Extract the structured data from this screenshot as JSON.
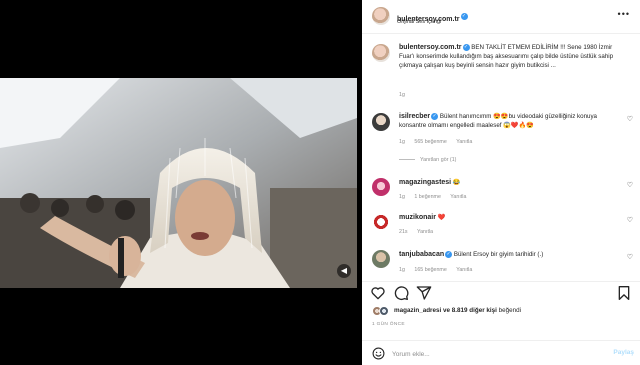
{
  "post": {
    "author": "bulentersoy.com.tr",
    "audio": "Orijinal Ses İçeriği"
  },
  "caption": {
    "username": "bulentersoy.com.tr",
    "text": "BEN TAKLİT ETMEM EDİLİRİM !!! Sene 1980 İzmir Fuar'ı konserimde kullandığım baş aksesuarımı çalıp bilde üstüne üstlük sahip çıkmaya çalışan kuş beyinli sensin hazır giyim butikcisi ...",
    "age": "1g"
  },
  "comments": [
    {
      "username": "isilrecber",
      "verified": true,
      "text": "Bülent hanımcımm 😍😍bu videodaki güzelliğiniz konuya konsantre olmamı engelledi maalesef 😱❤️🔥😍",
      "age": "1g",
      "likes": "565 beğenme",
      "reply": "Yanıtla",
      "replies": "Yanıtları gör (1)"
    },
    {
      "username": "magazingastesi",
      "text": "😂",
      "age": "1g",
      "likes": "1 beğenme",
      "reply": "Yanıtla"
    },
    {
      "username": "muzikonair",
      "text": "❤️",
      "age": "21s",
      "reply": "Yanıtla"
    },
    {
      "username": "tanjubabacan",
      "verified": true,
      "text": "Bülent Ersoy bir giyim tarihidir (.)",
      "age": "1g",
      "likes": "165 beğenme",
      "reply": "Yanıtla"
    }
  ],
  "likes": {
    "first_user": "magazin_adresi",
    "rest": "ve 8.819 diğer kişi",
    "suffix": "beğendi"
  },
  "date": "1 GÜN ÖNCE",
  "composer": {
    "placeholder": "Yorum ekle...",
    "post_label": "Paylaş"
  },
  "icons": {
    "like": "heart-icon",
    "comment": "comment-icon",
    "share": "send-icon",
    "save": "bookmark-icon",
    "emoji": "emoji-icon",
    "more": "more-icon",
    "mute": "speaker-icon"
  },
  "colors": {
    "verified": "#3897f0",
    "text": "#262626",
    "muted": "#8e8e8e",
    "post_button_disabled": "#b2dffc"
  }
}
